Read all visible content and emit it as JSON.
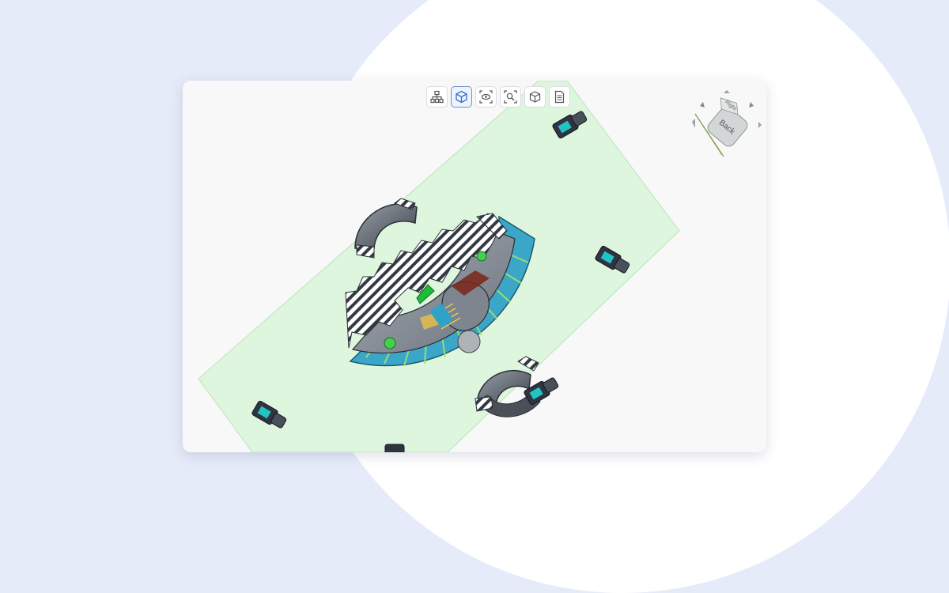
{
  "toolbar": {
    "buttons": [
      {
        "name": "tree-button",
        "icon": "hierarchy-tree-icon",
        "active": false
      },
      {
        "name": "cube-view-button",
        "icon": "cube-icon",
        "active": true
      },
      {
        "name": "visibility-button",
        "icon": "eye-frame-icon",
        "active": false
      },
      {
        "name": "fit-view-button",
        "icon": "zoom-fit-icon",
        "active": false
      },
      {
        "name": "model-button",
        "icon": "box-icon",
        "active": false
      },
      {
        "name": "document-button",
        "icon": "document-icon",
        "active": false
      }
    ]
  },
  "nav_cube": {
    "faces": {
      "top": "Right",
      "front": "Back"
    }
  },
  "colors": {
    "page_background": "#e6ebf9",
    "section_plane": "#d3f3d3",
    "gear_teeth": "#3aa7c9",
    "gear_body": "#8e95a0",
    "bolt": "#2f3440",
    "bolt_label": "#22c3c3",
    "arrow": "#20c040"
  }
}
